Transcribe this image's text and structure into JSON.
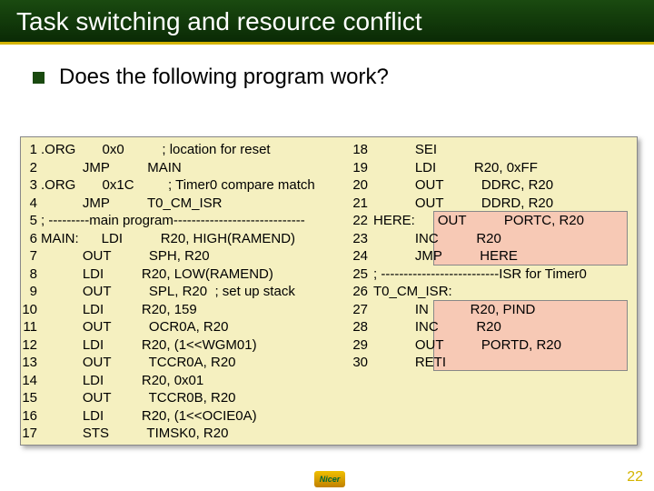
{
  "slide": {
    "title": "Task switching and resource conflict",
    "subtitle": "Does the following program work?",
    "page_number": "22",
    "logo_text": "Nicer"
  },
  "code_left": {
    "linenos": [
      "1",
      "2",
      "3",
      "4",
      "5",
      "6",
      "7",
      "8",
      "9",
      "10",
      "11",
      "12",
      "13",
      "14",
      "15",
      "16",
      "17"
    ],
    "lines": [
      ".ORG       0x0          ; location for reset",
      "           JMP          MAIN",
      ".ORG       0x1C         ; Timer0 compare match",
      "           JMP          T0_CM_ISR",
      "; ---------main program-----------------------------",
      "MAIN:      LDI          R20, HIGH(RAMEND)",
      "           OUT          SPH, R20",
      "           LDI          R20, LOW(RAMEND)",
      "           OUT          SPL, R20  ; set up stack",
      "           LDI          R20, 159",
      "           OUT          OCR0A, R20",
      "           LDI          R20, (1<<WGM01)",
      "           OUT          TCCR0A, R20",
      "           LDI          R20, 0x01",
      "           OUT          TCCR0B, R20",
      "           LDI          R20, (1<<OCIE0A)",
      "           STS          TIMSK0, R20"
    ]
  },
  "code_right": {
    "linenos": [
      "18",
      "19",
      "20",
      "21",
      "22",
      "23",
      "24",
      "25",
      "26",
      "27",
      "28",
      "29",
      "30"
    ],
    "lines": [
      "           SEI",
      "           LDI          R20, 0xFF",
      "           OUT          DDRC, R20",
      "           OUT          DDRD, R20",
      "HERE:      OUT          PORTC, R20",
      "           INC          R20",
      "           JMP          HERE",
      "; --------------------------ISR for Timer0",
      "T0_CM_ISR:",
      "           IN           R20, PIND",
      "           INC          R20",
      "           OUT          PORTD, R20",
      "           RETI"
    ]
  }
}
